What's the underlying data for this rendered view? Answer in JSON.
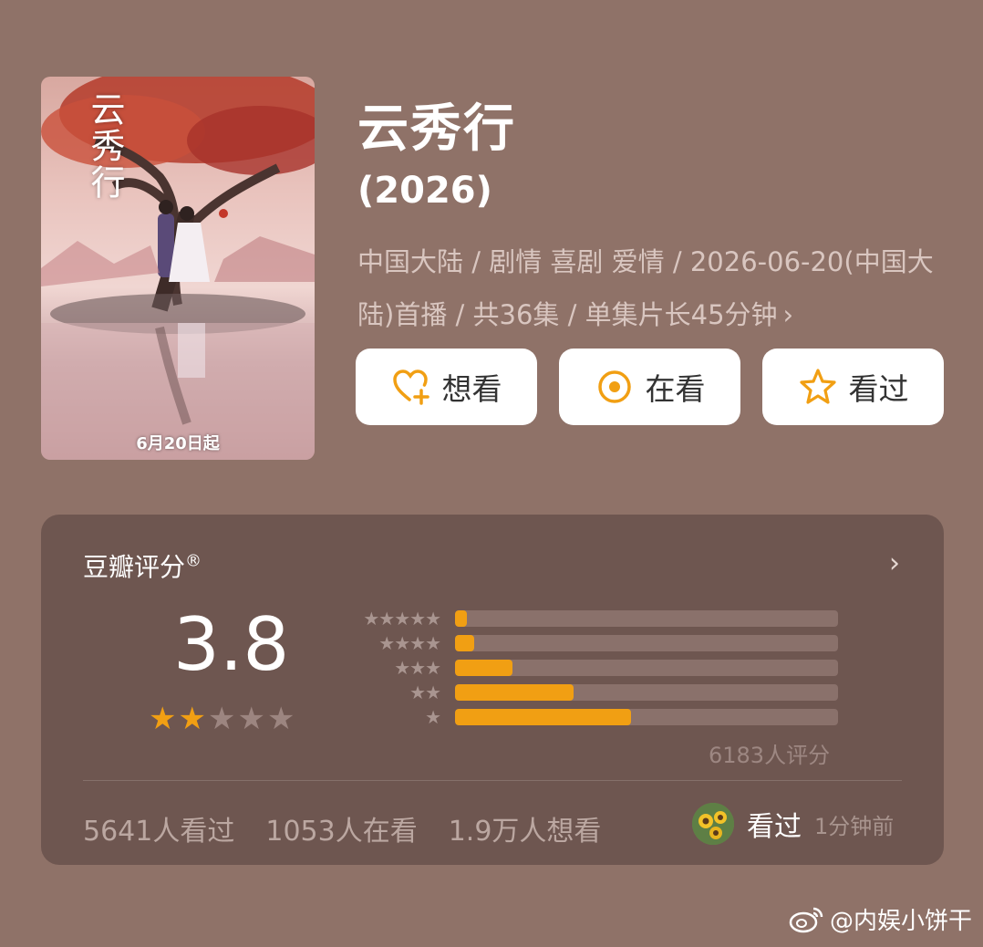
{
  "movie": {
    "poster_title": "云秀行",
    "poster_date": "6月20日起",
    "title": "云秀行",
    "year": "(2026)",
    "meta_line": "中国大陆 / 剧情 喜剧 爱情 / 2026-06-20(中国大陆)首播 / 共36集 / 单集片长45分钟",
    "meta_chevron": "›"
  },
  "actions": [
    {
      "label": "想看",
      "icon": "heart-plus-icon"
    },
    {
      "label": "在看",
      "icon": "target-icon"
    },
    {
      "label": "看过",
      "icon": "star-outline-icon"
    }
  ],
  "rating": {
    "label": "豆瓣评分",
    "registered": "®",
    "chevron": "›",
    "score": "3.8",
    "score_stars": 2,
    "distribution": [
      {
        "stars": "★★★★★",
        "fraction": 0.03
      },
      {
        "stars": "★★★★",
        "fraction": 0.05
      },
      {
        "stars": "★★★",
        "fraction": 0.15
      },
      {
        "stars": "★★",
        "fraction": 0.31
      },
      {
        "stars": "★",
        "fraction": 0.46
      }
    ],
    "total": "6183人评分"
  },
  "stats": {
    "watched": "5641人看过",
    "watching": "1053人在看",
    "want": "1.9万人想看"
  },
  "activity": {
    "action": "看过",
    "time": "1分钟前"
  },
  "watermark": "@内娱小饼干",
  "colors": {
    "accent": "#f19f13",
    "background": "#8f7268",
    "card": "#6e5650"
  }
}
